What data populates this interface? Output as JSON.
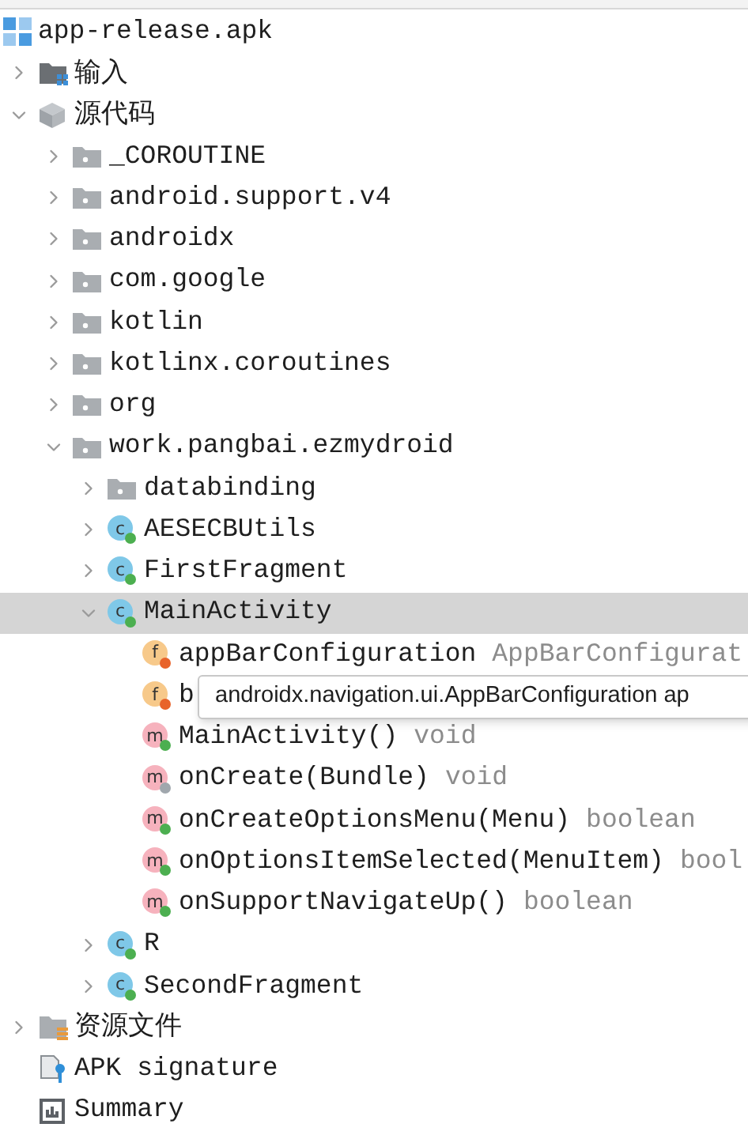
{
  "tree": {
    "kind": "apk",
    "label": "app-release.apk",
    "selected": false,
    "children": [
      {
        "kind": "input",
        "label": "输入",
        "expanded": false,
        "selected": false
      },
      {
        "kind": "source",
        "label": "源代码",
        "expanded": true,
        "selected": false,
        "children": [
          {
            "kind": "package",
            "label": "_COROUTINE",
            "expanded": false,
            "selected": false
          },
          {
            "kind": "package",
            "label": "android.support.v4",
            "expanded": false,
            "selected": false
          },
          {
            "kind": "package",
            "label": "androidx",
            "expanded": false,
            "selected": false
          },
          {
            "kind": "package",
            "label": "com.google",
            "expanded": false,
            "selected": false
          },
          {
            "kind": "package",
            "label": "kotlin",
            "expanded": false,
            "selected": false
          },
          {
            "kind": "package",
            "label": "kotlinx.coroutines",
            "expanded": false,
            "selected": false
          },
          {
            "kind": "package",
            "label": "org",
            "expanded": false,
            "selected": false
          },
          {
            "kind": "package",
            "label": "work.pangbai.ezmydroid",
            "expanded": true,
            "selected": false,
            "children": [
              {
                "kind": "package",
                "label": "databinding",
                "expanded": false,
                "selected": false
              },
              {
                "kind": "class",
                "icon_letter": "c",
                "color": "#4caf50",
                "label": "AESECBUtils",
                "expanded": false,
                "selected": false
              },
              {
                "kind": "class",
                "icon_letter": "c",
                "color": "#4caf50",
                "label": "FirstFragment",
                "expanded": false,
                "selected": false
              },
              {
                "kind": "class",
                "icon_letter": "c",
                "color": "#4caf50",
                "label": "MainActivity",
                "expanded": true,
                "selected": true,
                "children": [
                  {
                    "kind": "field",
                    "icon_letter": "f",
                    "color": "#e8632b",
                    "label": "appBarConfiguration",
                    "type": "AppBarConfigurat",
                    "selected": false
                  },
                  {
                    "kind": "field",
                    "icon_letter": "f",
                    "color": "#e8632b",
                    "label": "b",
                    "selected": false
                  },
                  {
                    "kind": "method",
                    "icon_letter": "m",
                    "color": "#4caf50",
                    "label": "MainActivity()",
                    "type": "void",
                    "selected": false
                  },
                  {
                    "kind": "method",
                    "icon_letter": "m",
                    "color": "#a0a7ad",
                    "label": "onCreate(Bundle)",
                    "type": "void",
                    "selected": false
                  },
                  {
                    "kind": "method",
                    "icon_letter": "m",
                    "color": "#4caf50",
                    "label": "onCreateOptionsMenu(Menu)",
                    "type": "boolean",
                    "selected": false
                  },
                  {
                    "kind": "method",
                    "icon_letter": "m",
                    "color": "#4caf50",
                    "label": "onOptionsItemSelected(MenuItem)",
                    "type": "bool",
                    "selected": false
                  },
                  {
                    "kind": "method",
                    "icon_letter": "m",
                    "color": "#4caf50",
                    "label": "onSupportNavigateUp()",
                    "type": "boolean",
                    "selected": false
                  }
                ]
              },
              {
                "kind": "class",
                "icon_letter": "c",
                "color": "#4caf50",
                "label": "R",
                "expanded": false,
                "selected": false
              },
              {
                "kind": "class",
                "icon_letter": "c",
                "color": "#4caf50",
                "label": "SecondFragment",
                "expanded": false,
                "selected": false
              }
            ]
          }
        ]
      },
      {
        "kind": "resources",
        "label": "资源文件",
        "expanded": false,
        "selected": false
      },
      {
        "kind": "signature",
        "label": "APK signature",
        "selected": false
      },
      {
        "kind": "summary",
        "label": "Summary",
        "selected": false
      }
    ]
  },
  "tooltip": {
    "text": "androidx.navigation.ui.AppBarConfiguration ap"
  }
}
